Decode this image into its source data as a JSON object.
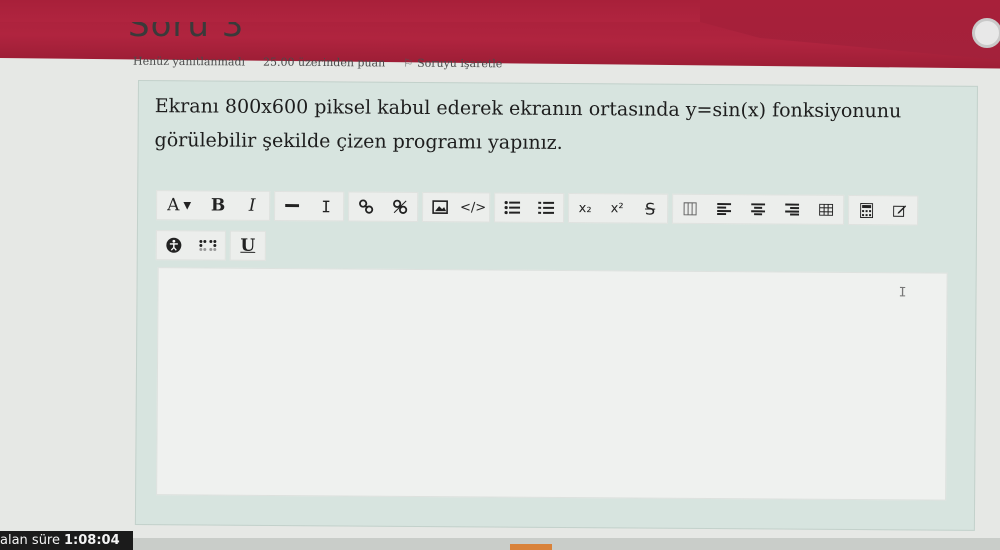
{
  "header": {
    "page_title": "Soru 3"
  },
  "question_meta": {
    "status": "Henüz yanıtlanmadı",
    "points": "25.00 üzerinden puan",
    "flag_label": "Soruyu işaretle"
  },
  "question": {
    "text": "Ekranı 800x600 piksel kabul ederek ekranın ortasında y=sin(x) fonksiyonunu görülebilir şekilde çizen programı yapınız."
  },
  "toolbar": {
    "font_label": "A",
    "bold_label": "B",
    "italic_label": "I",
    "subscript_label": "x₂",
    "superscript_label": "x²",
    "underline_label": "U"
  },
  "timer": {
    "label": "alan süre",
    "value": "1:08:04"
  },
  "colors": {
    "header_red": "#a8203a",
    "question_bg": "#d7e4df",
    "editor_bg": "#eff1ef"
  }
}
